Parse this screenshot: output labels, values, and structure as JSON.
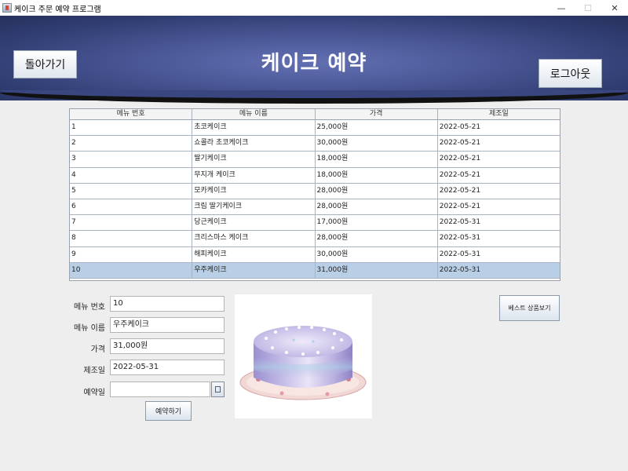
{
  "window": {
    "title": "케이크 주문 예약 프로그램",
    "minimize": "—",
    "maximize": "☐",
    "close": "✕"
  },
  "header": {
    "title": "케이크 예약",
    "back_label": "돌아가기",
    "logout_label": "로그아웃"
  },
  "table": {
    "columns": [
      "메뉴 번호",
      "메뉴 이름",
      "가격",
      "제조일"
    ],
    "rows": [
      [
        "1",
        "초코케이크",
        "25,000원",
        "2022-05-21"
      ],
      [
        "2",
        "쇼콜라 초코케이크",
        "30,000원",
        "2022-05-21"
      ],
      [
        "3",
        "딸기케이크",
        "18,000원",
        "2022-05-21"
      ],
      [
        "4",
        "무지개 케이크",
        "18,000원",
        "2022-05-21"
      ],
      [
        "5",
        "모카케이크",
        "28,000원",
        "2022-05-21"
      ],
      [
        "6",
        "크림 딸기케이크",
        "28,000원",
        "2022-05-21"
      ],
      [
        "7",
        "당근케이크",
        "17,000원",
        "2022-05-31"
      ],
      [
        "8",
        "크리스마스 케이크",
        "28,000원",
        "2022-05-31"
      ],
      [
        "9",
        "해피케이크",
        "30,000원",
        "2022-05-31"
      ],
      [
        "10",
        "우주케이크",
        "31,000원",
        "2022-05-31"
      ]
    ],
    "selected_row": 9
  },
  "form": {
    "menu_no_label": "메뉴 번호",
    "menu_no_value": "10",
    "menu_name_label": "메뉴 이름",
    "menu_name_value": "우주케이크",
    "price_label": "가격",
    "price_value": "31,000원",
    "made_date_label": "제조일",
    "made_date_value": "2022-05-31",
    "reserve_date_label": "예약일",
    "reserve_date_value": "",
    "reserve_button": "예약하기"
  },
  "best_button": "베스트 상품보기",
  "icons": {
    "app": "app-icon",
    "calendar": "calendar-icon"
  }
}
